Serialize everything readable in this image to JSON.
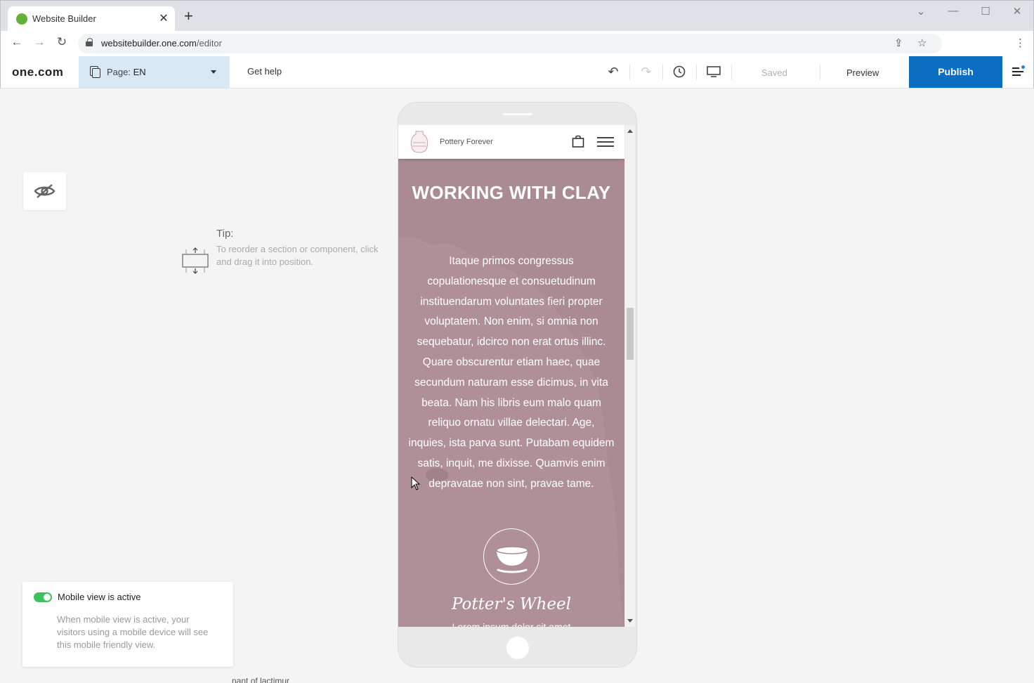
{
  "browser": {
    "tab_title": "Website Builder",
    "tab_close": "✕",
    "new_tab": "+",
    "url_host": "websitebuilder.one.com",
    "url_path": "/editor"
  },
  "editor": {
    "logo": "one.com",
    "page_label": "Page:",
    "page_value": "EN",
    "get_help": "Get help",
    "saved": "Saved",
    "preview": "Preview",
    "publish": "Publish"
  },
  "tip": {
    "title": "Tip:",
    "text": "To reorder a section or component, click and drag it into position."
  },
  "mobile_notice": {
    "title": "Mobile view is active",
    "text": "When mobile view is active, your visitors using a mobile device will see this mobile friendly view."
  },
  "footer_text": "nant of lactimur",
  "site": {
    "name": "Pottery Forever",
    "heading": "WORKING WITH CLAY",
    "body": "Itaque primos congressus copulationesque et consuetudinum instituendarum voluntates fieri propter voluptatem. Non enim, si omnia non sequebatur, idcirco non erat ortus illinc. Quare obscurentur etiam haec, quae secundum naturam esse dicimus, in vita beata. Nam his libris eum malo quam reliquo ornatu villae delectari. Age, inquies, ista parva sunt. Putabam equidem satis, inquit, me dixisse. Quamvis enim depravatae non sint, pravae tame.",
    "feature_title": "Potter's Wheel",
    "feature_text": "Lorem ipsum dolor sit amet"
  },
  "colors": {
    "accent": "#0a6fc2",
    "toggle_on": "#3cc15f",
    "section_bg": "#a98b91"
  }
}
